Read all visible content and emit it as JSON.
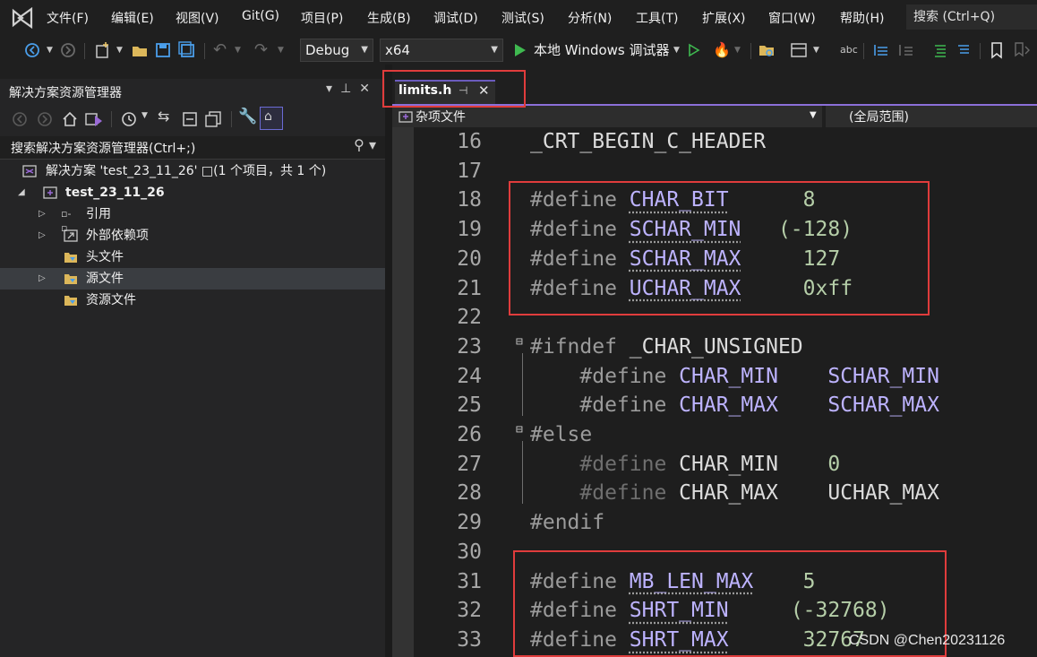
{
  "menubar": {
    "items": [
      "文件(F)",
      "编辑(E)",
      "视图(V)",
      "Git(G)",
      "项目(P)",
      "生成(B)",
      "调试(D)",
      "测试(S)",
      "分析(N)",
      "工具(T)",
      "扩展(X)",
      "窗口(W)",
      "帮助(H)"
    ],
    "search_label": "搜索 (Ctrl+Q)"
  },
  "toolbar": {
    "config": "Debug",
    "platform": "x64",
    "run_label": "本地 Windows 调试器"
  },
  "solution_explorer": {
    "title": "解决方案资源管理器",
    "search_placeholder": "搜索解决方案资源管理器(Ctrl+;)",
    "tree": {
      "solution": "解决方案 'test_23_11_26' □(1 个项目，共 1 个)",
      "project": "test_23_11_26",
      "references": "引用",
      "external_deps": "外部依赖项",
      "header_files": "头文件",
      "source_files": "源文件",
      "resource_files": "资源文件"
    }
  },
  "editor": {
    "tab": {
      "label": "limits.h"
    },
    "nav": {
      "left": "杂项文件",
      "right": "(全局范围)"
    },
    "lines": [
      {
        "n": "16",
        "tokens": [
          [
            "pl",
            "_CRT_BEGIN_C_HEADER"
          ]
        ]
      },
      {
        "n": "17",
        "tokens": []
      },
      {
        "n": "18",
        "tokens": [
          [
            "kw",
            "#define "
          ],
          [
            "mcu",
            "CHAR_BIT"
          ],
          [
            "pl",
            "      "
          ],
          [
            "num",
            "8"
          ]
        ]
      },
      {
        "n": "19",
        "tokens": [
          [
            "kw",
            "#define "
          ],
          [
            "mcu",
            "SCHAR_MIN"
          ],
          [
            "pl",
            "   "
          ],
          [
            "num",
            "(-128)"
          ]
        ]
      },
      {
        "n": "20",
        "tokens": [
          [
            "kw",
            "#define "
          ],
          [
            "mcu",
            "SCHAR_MAX"
          ],
          [
            "pl",
            "     "
          ],
          [
            "num",
            "127"
          ]
        ]
      },
      {
        "n": "21",
        "tokens": [
          [
            "kw",
            "#define "
          ],
          [
            "mcu",
            "UCHAR_MAX"
          ],
          [
            "pl",
            "     "
          ],
          [
            "num",
            "0xff"
          ]
        ]
      },
      {
        "n": "22",
        "tokens": []
      },
      {
        "n": "23",
        "tokens": [
          [
            "kw",
            "#ifndef "
          ],
          [
            "pl",
            "_CHAR_UNSIGNED"
          ]
        ]
      },
      {
        "n": "24",
        "tokens": [
          [
            "pl",
            "    "
          ],
          [
            "kw",
            "#define "
          ],
          [
            "mc",
            "CHAR_MIN"
          ],
          [
            "pl",
            "    "
          ],
          [
            "mc",
            "SCHAR_MIN"
          ]
        ]
      },
      {
        "n": "25",
        "tokens": [
          [
            "pl",
            "    "
          ],
          [
            "kw",
            "#define "
          ],
          [
            "mc",
            "CHAR_MAX"
          ],
          [
            "pl",
            "    "
          ],
          [
            "mc",
            "SCHAR_MAX"
          ]
        ]
      },
      {
        "n": "26",
        "tokens": [
          [
            "kw",
            "#else"
          ]
        ]
      },
      {
        "n": "27",
        "tokens": [
          [
            "pl",
            "    "
          ],
          [
            "dim",
            "#define "
          ],
          [
            "pl",
            "CHAR_MIN"
          ],
          [
            "pl",
            "    "
          ],
          [
            "num",
            "0"
          ]
        ]
      },
      {
        "n": "28",
        "tokens": [
          [
            "pl",
            "    "
          ],
          [
            "dim",
            "#define "
          ],
          [
            "pl",
            "CHAR_MAX"
          ],
          [
            "pl",
            "    "
          ],
          [
            "pl",
            "UCHAR_MAX"
          ]
        ]
      },
      {
        "n": "29",
        "tokens": [
          [
            "kw",
            "#endif"
          ]
        ]
      },
      {
        "n": "30",
        "tokens": []
      },
      {
        "n": "31",
        "tokens": [
          [
            "kw",
            "#define "
          ],
          [
            "mcu",
            "MB_LEN_MAX"
          ],
          [
            "pl",
            "    "
          ],
          [
            "num",
            "5"
          ]
        ]
      },
      {
        "n": "32",
        "tokens": [
          [
            "kw",
            "#define "
          ],
          [
            "mcu",
            "SHRT_MIN"
          ],
          [
            "pl",
            "     "
          ],
          [
            "num",
            "(-32768)"
          ]
        ]
      },
      {
        "n": "33",
        "tokens": [
          [
            "kw",
            "#define "
          ],
          [
            "mcu",
            "SHRT_MAX"
          ],
          [
            "pl",
            "      "
          ],
          [
            "num",
            "32767"
          ]
        ]
      }
    ]
  },
  "watermark": "CSDN @Chen20231126"
}
